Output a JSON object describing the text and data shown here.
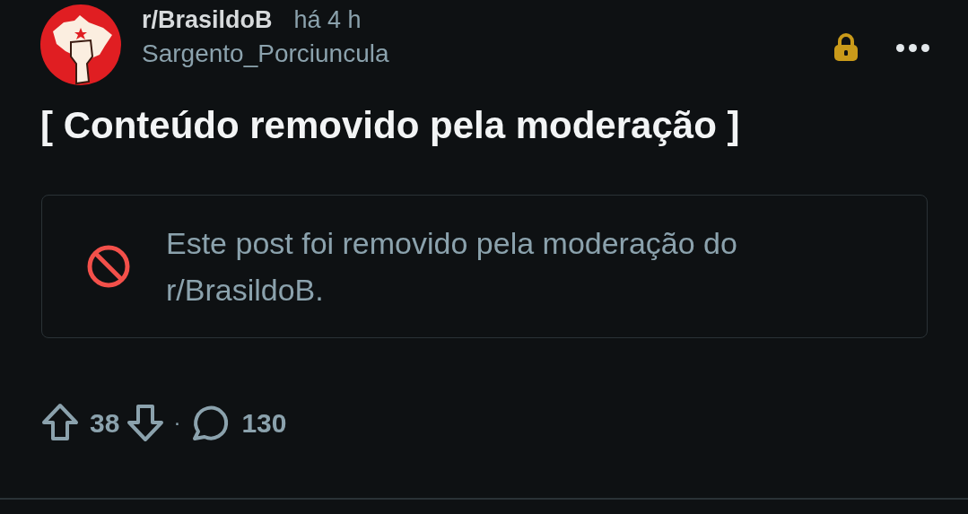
{
  "post": {
    "subreddit": "r/BrasildoB",
    "time": "há 4 h",
    "author": "Sargento_Porciuncula",
    "locked": true,
    "title": "[ Conteúdo removido pela moderação ]",
    "removal_notice": "Este post foi removido pela moderação do r/BrasildoB.",
    "upvotes": "38",
    "separator": "·",
    "comments": "130"
  }
}
